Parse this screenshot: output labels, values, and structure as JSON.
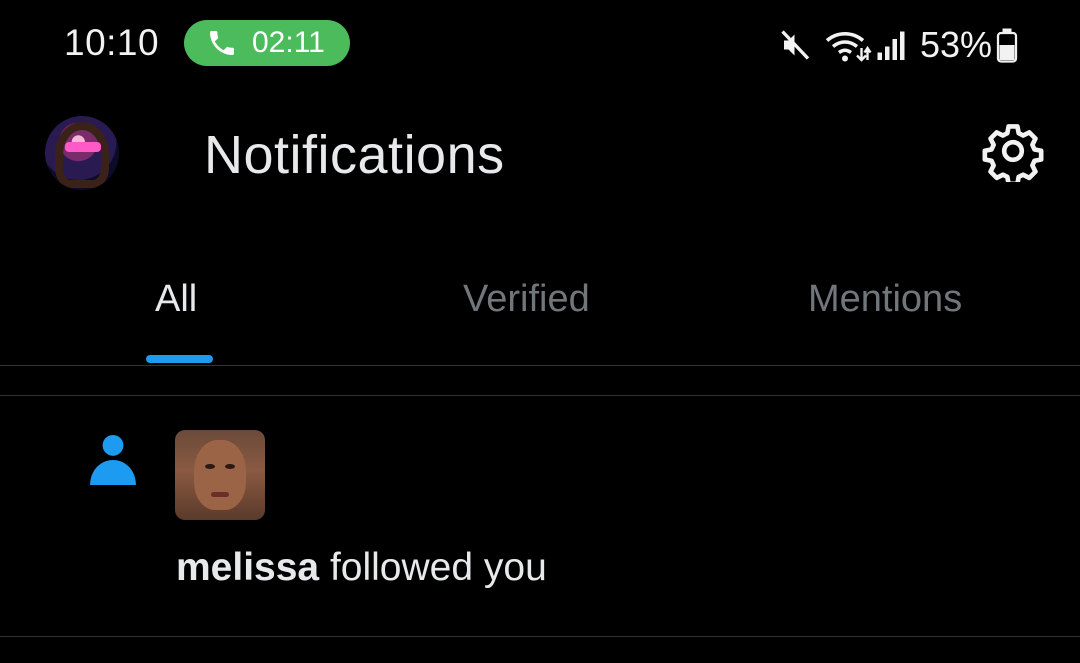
{
  "status_bar": {
    "time": "10:10",
    "call_duration": "02:11",
    "battery_percent": "53%",
    "icons": [
      "phone-icon",
      "mute-icon",
      "wifi-icon",
      "signal-icon",
      "battery-icon"
    ],
    "call_pill_color": "#4cbb5c"
  },
  "header": {
    "title": "Notifications",
    "avatar": "profile-avatar",
    "settings_icon": "gear-icon"
  },
  "tabs": [
    {
      "label": "All",
      "active": true
    },
    {
      "label": "Verified",
      "active": false
    },
    {
      "label": "Mentions",
      "active": false
    }
  ],
  "accent_color": "#1d9bf0",
  "notifications": [
    {
      "type": "follow",
      "icon": "person-icon",
      "user": "melissa",
      "action": "followed you"
    }
  ]
}
